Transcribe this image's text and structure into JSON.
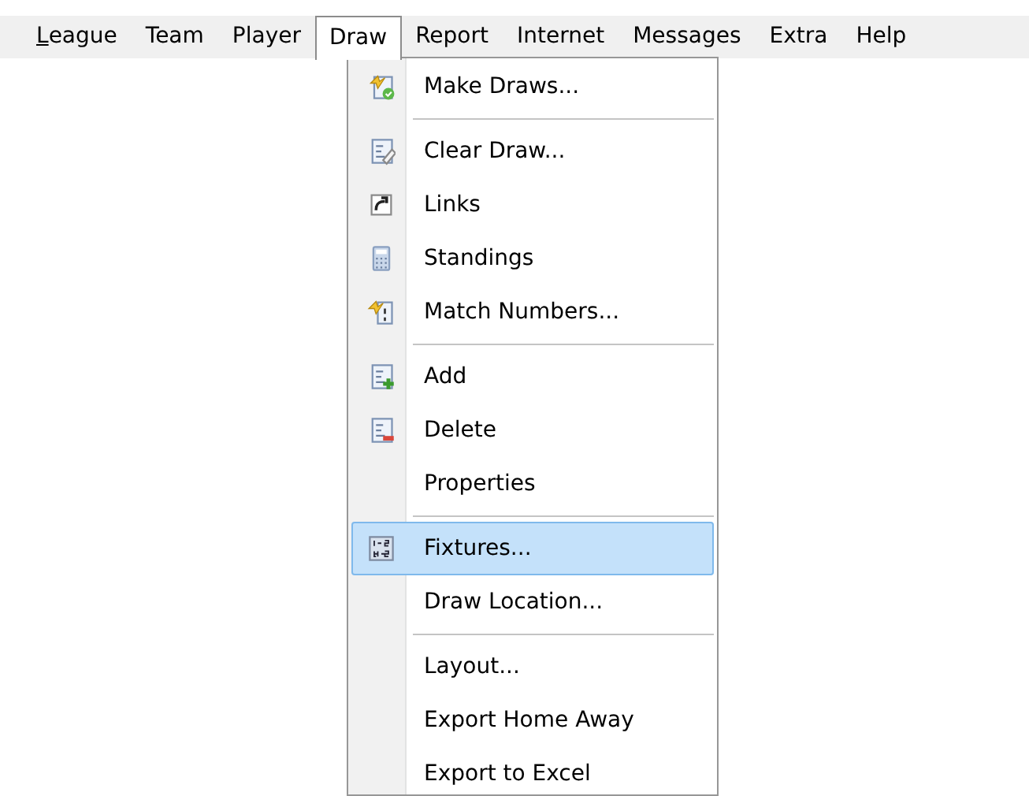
{
  "menu_bar": [
    {
      "label": "League",
      "selected": false,
      "mnemonic_underlined": true
    },
    {
      "label": "Team",
      "selected": false,
      "mnemonic_underlined": false
    },
    {
      "label": "Player",
      "selected": false,
      "mnemonic_underlined": false
    },
    {
      "label": "Draw",
      "selected": true,
      "mnemonic_underlined": false
    },
    {
      "label": "Report",
      "selected": false,
      "mnemonic_underlined": false
    },
    {
      "label": "Internet",
      "selected": false,
      "mnemonic_underlined": false
    },
    {
      "label": "Messages",
      "selected": false,
      "mnemonic_underlined": false
    },
    {
      "label": "Extra",
      "selected": false,
      "mnemonic_underlined": false
    },
    {
      "label": "Help",
      "selected": false,
      "mnemonic_underlined": false
    }
  ],
  "draw_menu": [
    {
      "kind": "item",
      "label": "Make Draws...",
      "has_icon": true,
      "selected": false
    },
    {
      "kind": "separator"
    },
    {
      "kind": "item",
      "label": "Clear Draw...",
      "has_icon": true,
      "selected": false
    },
    {
      "kind": "item",
      "label": "Links",
      "has_icon": true,
      "selected": false
    },
    {
      "kind": "item",
      "label": "Standings",
      "has_icon": true,
      "selected": false
    },
    {
      "kind": "item",
      "label": "Match Numbers...",
      "has_icon": true,
      "selected": false
    },
    {
      "kind": "separator"
    },
    {
      "kind": "item",
      "label": "Add",
      "has_icon": true,
      "selected": false
    },
    {
      "kind": "item",
      "label": "Delete",
      "has_icon": true,
      "selected": false
    },
    {
      "kind": "item",
      "label": "Properties",
      "has_icon": false,
      "selected": false
    },
    {
      "kind": "separator"
    },
    {
      "kind": "item",
      "label": "Fixtures...",
      "has_icon": true,
      "selected": true
    },
    {
      "kind": "item",
      "label": "Draw Location...",
      "has_icon": false,
      "selected": false
    },
    {
      "kind": "separator"
    },
    {
      "kind": "item",
      "label": "Layout...",
      "has_icon": false,
      "selected": false
    },
    {
      "kind": "item",
      "label": "Export Home Away",
      "has_icon": false,
      "selected": false
    },
    {
      "kind": "item",
      "label": "Export to Excel",
      "has_icon": false,
      "selected": false
    }
  ]
}
